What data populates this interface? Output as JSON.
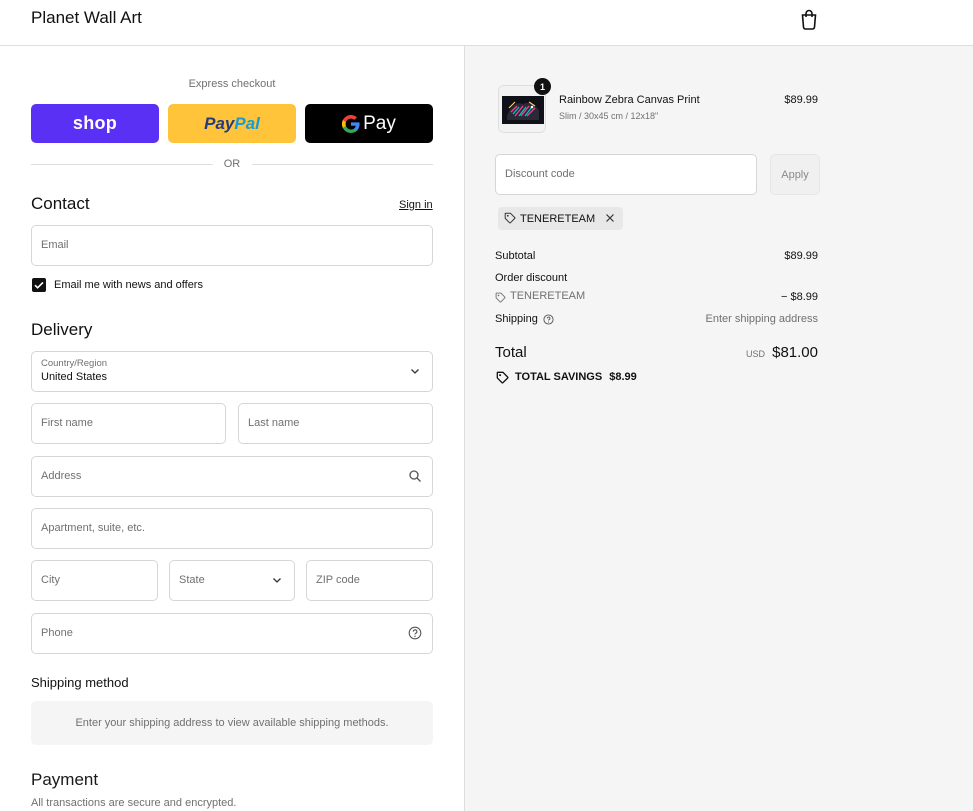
{
  "header": {
    "brand": "Planet Wall Art",
    "cart_icon": "shopping-bag-icon"
  },
  "express": {
    "label": "Express checkout",
    "shop_label": "shop",
    "paypal_label_1": "Pay",
    "paypal_label_2": "Pal",
    "gpay_g": "G",
    "gpay_label": "Pay",
    "or_label": "OR"
  },
  "contact": {
    "title": "Contact",
    "sign_in": "Sign in",
    "email_placeholder": "Email",
    "news_checkbox_label": "Email me with news and offers",
    "news_checked": true
  },
  "delivery": {
    "title": "Delivery",
    "country_label": "Country/Region",
    "country_value": "United States",
    "first_name_placeholder": "First name",
    "last_name_placeholder": "Last name",
    "address_placeholder": "Address",
    "apartment_placeholder": "Apartment, suite, etc.",
    "city_placeholder": "City",
    "state_placeholder": "State",
    "zip_placeholder": "ZIP code",
    "phone_placeholder": "Phone"
  },
  "shipping_method": {
    "title": "Shipping method",
    "message": "Enter your shipping address to view available shipping methods."
  },
  "payment": {
    "title": "Payment",
    "subtitle": "All transactions are secure and encrypted."
  },
  "summary": {
    "product": {
      "name": "Rainbow Zebra Canvas Print",
      "variant": "Slim / 30x45 cm / 12x18\"",
      "price": "$89.99",
      "quantity": "1"
    },
    "discount_placeholder": "Discount code",
    "apply_label": "Apply",
    "applied_code": "TENERETEAM",
    "subtotal_label": "Subtotal",
    "subtotal_value": "$89.99",
    "order_discount_label": "Order discount",
    "discount_code": "TENERETEAM",
    "discount_value": "− $8.99",
    "shipping_label": "Shipping",
    "shipping_value": "Enter shipping address",
    "total_label": "Total",
    "total_currency": "USD",
    "total_value": "$81.00",
    "savings_label": "TOTAL SAVINGS",
    "savings_value": "$8.99"
  },
  "colors": {
    "shop_purple": "#5a31f4",
    "paypal_yellow": "#ffc439",
    "gpay_black": "#000000",
    "summary_bg": "#f5f5f5"
  }
}
